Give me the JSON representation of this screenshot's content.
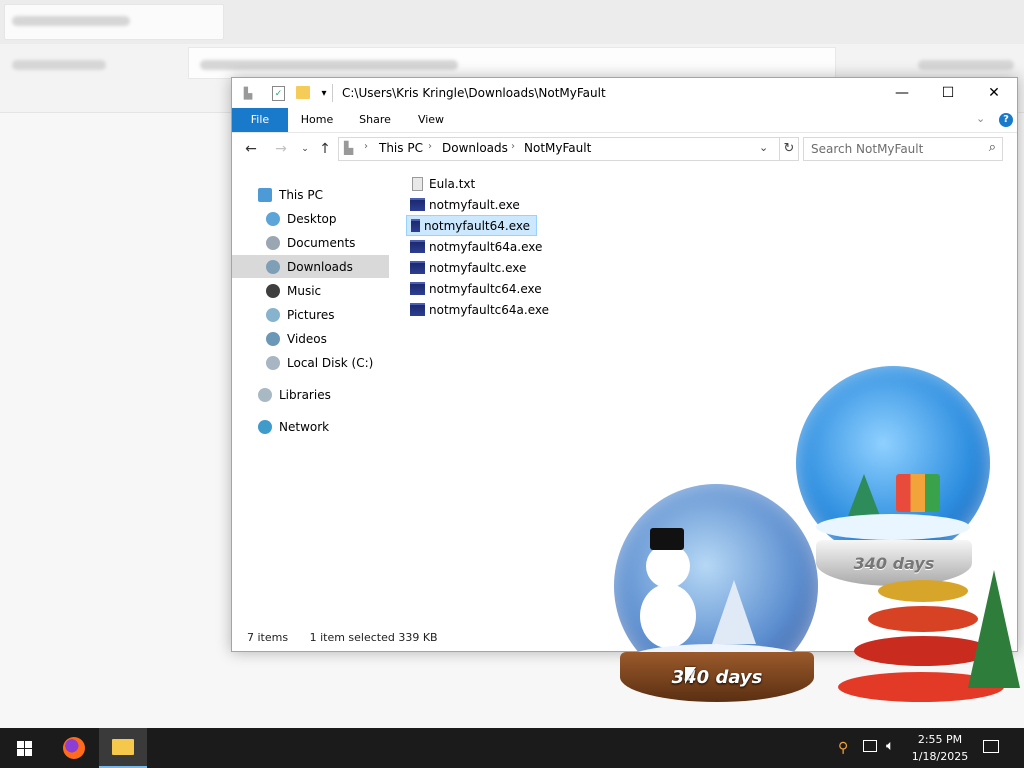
{
  "window": {
    "path": "C:\\Users\\Kris Kringle\\Downloads\\NotMyFault",
    "controls": {
      "minimize": "—",
      "maximize": "☐",
      "close": "✕"
    }
  },
  "ribbon": {
    "tabs": [
      "File",
      "Home",
      "Share",
      "View"
    ]
  },
  "address": {
    "crumbs": [
      "This PC",
      "Downloads",
      "NotMyFault"
    ]
  },
  "search": {
    "placeholder": "Search NotMyFault"
  },
  "nav": {
    "items": [
      {
        "label": "This PC",
        "icon": "pc-icon"
      },
      {
        "label": "Desktop",
        "icon": "desktop-icon"
      },
      {
        "label": "Documents",
        "icon": "documents-icon"
      },
      {
        "label": "Downloads",
        "icon": "downloads-icon",
        "selected": true
      },
      {
        "label": "Music",
        "icon": "music-icon"
      },
      {
        "label": "Pictures",
        "icon": "pictures-icon"
      },
      {
        "label": "Videos",
        "icon": "videos-icon"
      },
      {
        "label": "Local Disk (C:)",
        "icon": "disk-icon"
      },
      {
        "label": "Libraries",
        "icon": "libraries-icon"
      },
      {
        "label": "Network",
        "icon": "network-icon"
      }
    ]
  },
  "files": [
    {
      "name": "Eula.txt",
      "type": "txt"
    },
    {
      "name": "notmyfault.exe",
      "type": "exe"
    },
    {
      "name": "notmyfault64.exe",
      "type": "exe",
      "selected": true
    },
    {
      "name": "notmyfault64a.exe",
      "type": "exe"
    },
    {
      "name": "notmyfaultc.exe",
      "type": "exe"
    },
    {
      "name": "notmyfaultc64.exe",
      "type": "exe"
    },
    {
      "name": "notmyfaultc64a.exe",
      "type": "exe"
    }
  ],
  "status": {
    "count": "7 items",
    "selection": "1 item selected  339 KB"
  },
  "widget": {
    "globe_back_label": "340 days",
    "globe_front_label": "340 days"
  },
  "taskbar": {
    "time": "2:55 PM",
    "date": "1/18/2025"
  },
  "colors": {
    "accent": "#1979ca",
    "selected_bg": "#cce8ff",
    "taskbar": "#1b1b1b"
  }
}
